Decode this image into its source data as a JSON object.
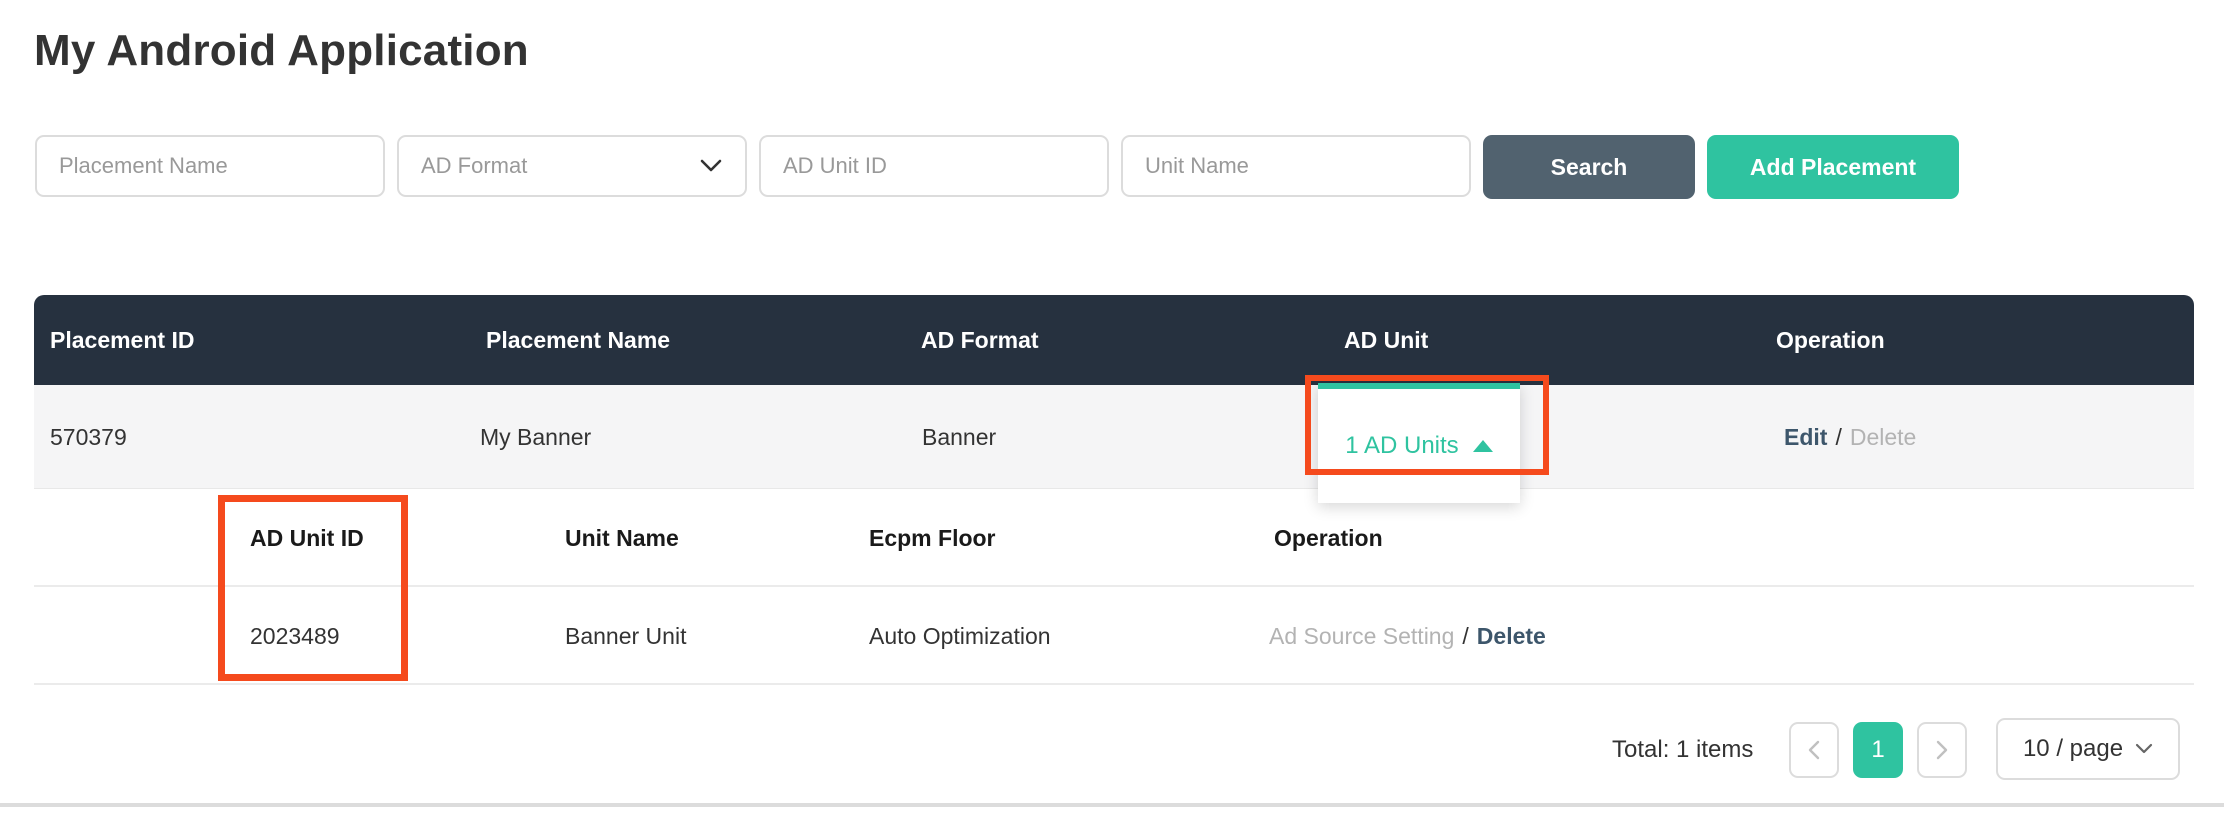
{
  "page": {
    "title": "My Android Application"
  },
  "filters": {
    "placement_name_placeholder": "Placement Name",
    "ad_format_label": "AD Format",
    "ad_unit_id_placeholder": "AD Unit ID",
    "unit_name_placeholder": "Unit Name",
    "search_label": "Search",
    "add_placement_label": "Add Placement"
  },
  "table": {
    "headers": [
      "Placement ID",
      "Placement Name",
      "AD Format",
      "AD Unit",
      "Operation"
    ],
    "row": {
      "placement_id": "570379",
      "placement_name": "My Banner",
      "ad_format": "Banner",
      "ad_unit_toggle_label": "1 AD Units",
      "operation": {
        "edit": "Edit",
        "separator": "/",
        "delete": "Delete"
      }
    }
  },
  "subtable": {
    "headers": [
      "AD Unit ID",
      "Unit Name",
      "Ecpm Floor",
      "Operation"
    ],
    "row": {
      "ad_unit_id": "2023489",
      "unit_name": "Banner Unit",
      "ecpm_floor": "Auto Optimization",
      "operation": {
        "ad_source_setting": "Ad Source Setting",
        "separator": "/",
        "delete": "Delete"
      }
    }
  },
  "pagination": {
    "total_text": "Total: 1 items",
    "current_page": "1",
    "page_size_label": "10 / page"
  },
  "colors": {
    "accent_green": "#2fc3a0",
    "table_header_bg": "#26313f",
    "search_button_bg": "#51626f",
    "annotation_red": "#f54a1d",
    "muted_link": "#b3b3b3",
    "strong_link": "#3d566b",
    "row_bg": "#f5f5f6"
  }
}
